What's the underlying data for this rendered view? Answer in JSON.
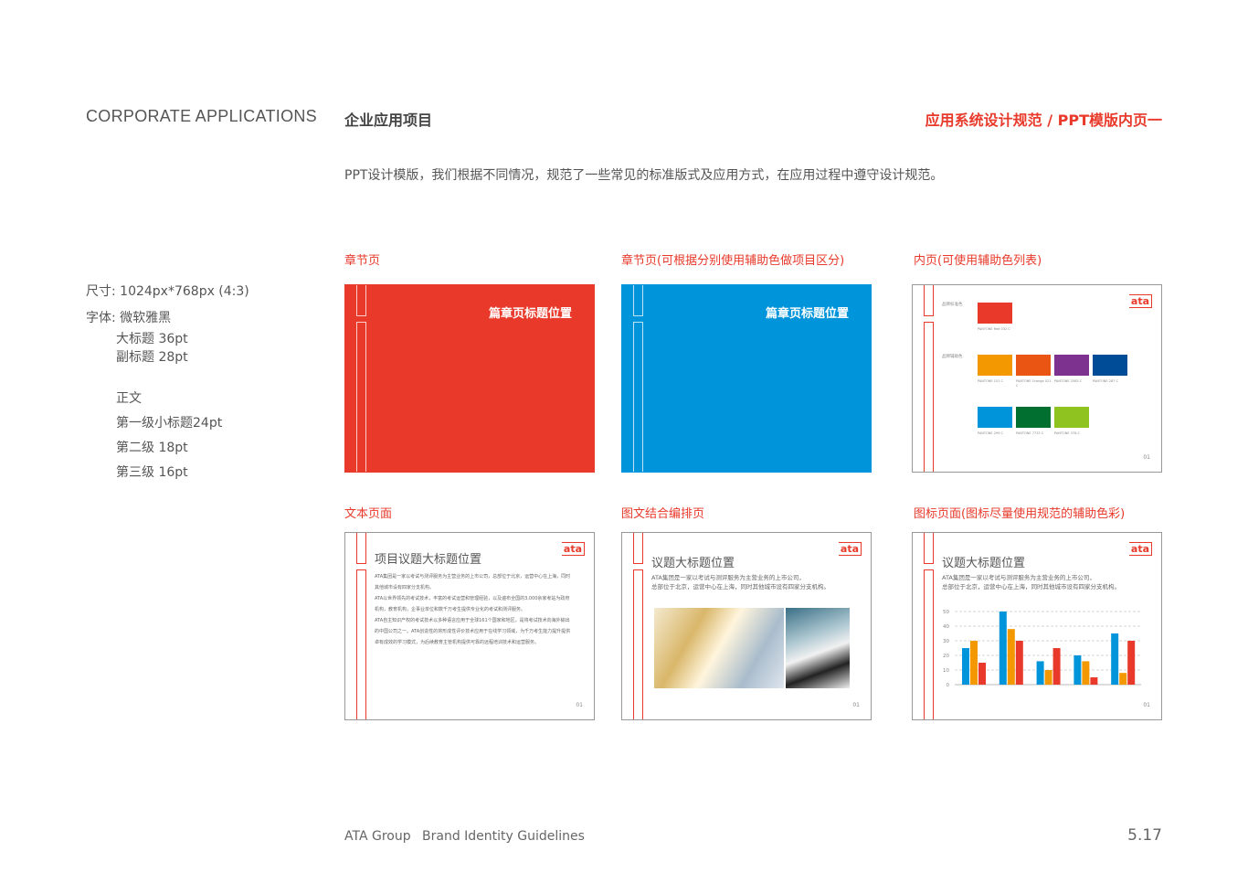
{
  "header": {
    "title_en": "CORPORATE APPLICATIONS",
    "title_cn": "企业应用项目",
    "section": "应用系统设计规范 / PPT模版内页一"
  },
  "intro": "PPT设计模版，我们根据不同情况，规范了一些常见的标准版式及应用方式，在应用过程中遵守设计规范。",
  "specs": {
    "size": "尺寸: 1024px*768px (4:3)",
    "font": "字体: 微软雅黑",
    "title": "大标题  36pt",
    "subtitle": "副标题  28pt",
    "body": "正文",
    "level1": "第一级小标题24pt",
    "level2": "第二级 18pt",
    "level3": "第三级 16pt"
  },
  "slides": {
    "chapter_red": {
      "label": "章节页",
      "title": "篇章页标题位置",
      "color": "#e8392a"
    },
    "chapter_blue": {
      "label": "章节页(可根据分别使用辅助色做项目区分)",
      "title": "篇章页标题位置",
      "color": "#0095da"
    },
    "colors": {
      "label": "内页(可使用辅助色列表)",
      "logo": "ata",
      "page": "01",
      "primary_label": "品牌标准色",
      "secondary_label": "品牌辅助色",
      "primary": {
        "color": "#e8392a",
        "text": "PANTONE Red 032 C"
      },
      "secondary": [
        {
          "color": "#f39800",
          "text": "PANTONE 151 C"
        },
        {
          "color": "#ea5514",
          "text": "PANTONE Orange 021 C"
        },
        {
          "color": "#7d3290",
          "text": "PANTONE 2583 C"
        },
        {
          "color": "#004c97",
          "text": "PANTONE 287 C"
        },
        {
          "color": "#0095da",
          "text": "PANTONE 299 C"
        },
        {
          "color": "#006f2f",
          "text": "PANTONE 7733 C"
        },
        {
          "color": "#8fc31f",
          "text": "PANTONE 376 C"
        }
      ]
    },
    "text": {
      "label": "文本页面",
      "logo": "ata",
      "page": "01",
      "title": "项目议题大标题位置",
      "lines": [
        "ATA集团是一家以考试与测评服务为主营业务的上市公司，总部位于北京，运营中心在上海，同时",
        "其他城市设有四家分支机构。",
        "ATA以世界领先的考试技术，丰富的考试运营和管理经验，以及遍布全国的3,000余家考站为政府",
        "机构，教育机构，企事业单位和数千万考生提供专业化的考试和测评服务。",
        "ATA自主知识产权的考试技术以多种语言应用于全球161个国家和地区，是将考试技术向海外输出",
        "的中国公司之一。ATA创造性的将形成性评价技术应用于在线学习领域，为千万考生能力提升提供",
        "卓有成效的学习模式，为后续教育主管机构提供可靠的远程培训技术和运营服务。"
      ]
    },
    "image": {
      "label": "图文结合编排页",
      "logo": "ata",
      "page": "01",
      "title": "议题大标题位置",
      "lines": [
        "ATA集团是一家以考试与测评服务为主营业务的上市公司，",
        "总部位于北京，运营中心在上海，同时其他城市设有四家分支机构。"
      ]
    },
    "chart": {
      "label": "图标页面(图标尽量使用规范的辅助色彩)",
      "logo": "ata",
      "page": "01",
      "title": "议题大标题位置",
      "lines": [
        "ATA集团是一家以考试与测评服务为主营业务的上市公司，",
        "总部位于北京，运营中心在上海，同时其他城市设有四家分支机构。"
      ]
    }
  },
  "chart_data": {
    "type": "bar",
    "categories": [
      "1",
      "2",
      "3",
      "4",
      "5"
    ],
    "ylim": [
      0,
      50
    ],
    "yticks": [
      0,
      10,
      20,
      30,
      40,
      50
    ],
    "grid": true,
    "series": [
      {
        "color": "#0095da",
        "values": [
          25,
          50,
          16,
          20,
          35
        ]
      },
      {
        "color": "#f39800",
        "values": [
          30,
          38,
          10,
          16,
          8
        ]
      },
      {
        "color": "#e8392a",
        "values": [
          15,
          30,
          25,
          5,
          30
        ]
      }
    ]
  },
  "footer": {
    "company": "ATA Group",
    "doc": "Brand Identity Guidelines",
    "page": "5.17"
  }
}
